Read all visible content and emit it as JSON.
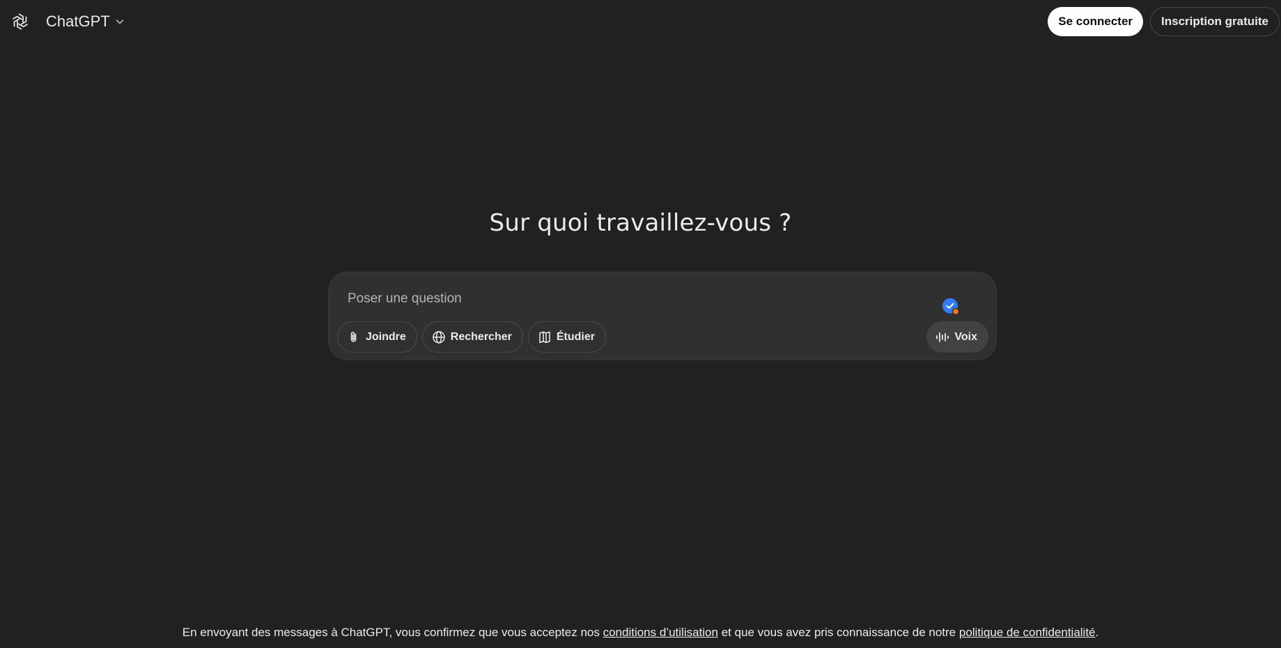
{
  "header": {
    "logo_icon": "openai-logo-icon",
    "model_name": "ChatGPT",
    "model_chevron_icon": "chevron-down-icon",
    "login_label": "Se connecter",
    "signup_label": "Inscription gratuite"
  },
  "main": {
    "headline": "Sur quoi travaillez-vous ?",
    "composer": {
      "placeholder": "Poser une question",
      "value": "",
      "tools": [
        {
          "label": "Joindre",
          "icon": "paperclip-icon"
        },
        {
          "label": "Rechercher",
          "icon": "globe-icon"
        },
        {
          "label": "Étudier",
          "icon": "book-icon"
        }
      ],
      "voice_label": "Voix",
      "voice_icon": "waveform-icon",
      "badge_icon": "check-badge-icon"
    }
  },
  "footer": {
    "text_before": "En envoyant des messages à ChatGPT, vous confirmez que vous acceptez nos ",
    "terms_link": "conditions d’utilisation",
    "text_middle": " et que vous avez pris connaissance de notre ",
    "privacy_link": "politique de confidentialité",
    "text_after": "."
  },
  "colors": {
    "background": "#212121",
    "composer": "#303030",
    "text": "#ececec",
    "accent_blue": "#2f7cf6",
    "badge_orange": "#f97316"
  }
}
